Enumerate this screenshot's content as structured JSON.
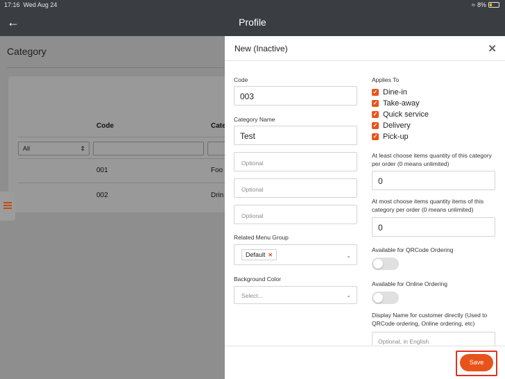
{
  "status_bar": {
    "time": "17:16",
    "date": "Wed Aug 24",
    "wifi_icon": "wifi-icon",
    "battery": "8%"
  },
  "nav": {
    "title": "Profile",
    "back_icon": "arrow-left-icon"
  },
  "background": {
    "title": "Category",
    "columns": [
      "Code",
      "Cate"
    ],
    "filter_select": "All",
    "rows": [
      {
        "code": "001",
        "category": "Foo"
      },
      {
        "code": "002",
        "category": "Drin"
      }
    ]
  },
  "modal": {
    "title": "New (Inactive)",
    "close_icon": "close-icon",
    "code_label": "Code",
    "code_value": "003",
    "category_name_label": "Category Name",
    "category_name_value": "Test",
    "optional_placeholders": [
      "Optional",
      "Optional",
      "Optional"
    ],
    "related_menu_group_label": "Related Menu Group",
    "related_menu_group_tag": "Default",
    "background_color_label": "Background Color",
    "background_color_placeholder": "Select...",
    "applies_to_label": "Applies To",
    "applies_to": [
      "Dine-in",
      "Take-away",
      "Quick service",
      "Delivery",
      "Pick-up"
    ],
    "min_qty_label": "At least choose items quantity of this category per order (0 means unlimited)",
    "min_qty_value": "0",
    "max_qty_label": "At most choose items quantity items of this category per order (0 means unlimited)",
    "max_qty_value": "0",
    "qrcode_label": "Available for QRCode Ordering",
    "online_label": "Available for Online Ordering",
    "display_name_label": "Display Name for customer directly (Used to QRCode ordering, Online ordering, etc)",
    "display_name_placeholder": "Optional, in English",
    "save_label": "Save"
  },
  "colors": {
    "accent": "#e8531c",
    "nav_bg": "#3a3d42",
    "highlight": "#e03020"
  }
}
